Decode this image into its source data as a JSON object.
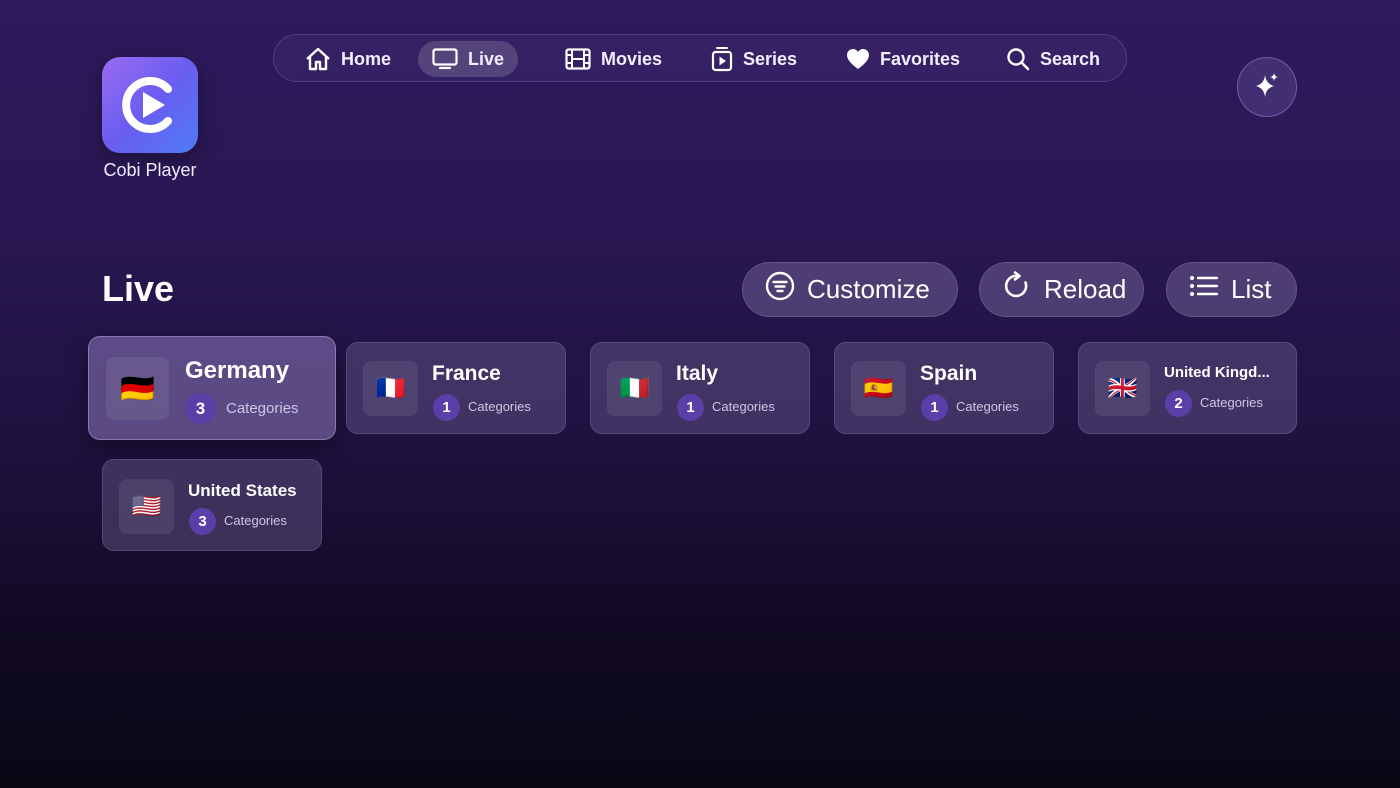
{
  "app": {
    "name": "Cobi Player"
  },
  "nav": {
    "items": [
      {
        "label": "Home",
        "icon": "home-icon"
      },
      {
        "label": "Live",
        "icon": "tv-icon",
        "active": true
      },
      {
        "label": "Movies",
        "icon": "film-icon"
      },
      {
        "label": "Series",
        "icon": "series-icon"
      },
      {
        "label": "Favorites",
        "icon": "heart-icon"
      },
      {
        "label": "Search",
        "icon": "search-icon"
      }
    ]
  },
  "page": {
    "title": "Live"
  },
  "actions": {
    "customize": "Customize",
    "reload": "Reload",
    "list": "List"
  },
  "countries": [
    {
      "name": "Germany",
      "count": "3",
      "sub": "Categories",
      "flag": "🇩🇪",
      "focused": true
    },
    {
      "name": "France",
      "count": "1",
      "sub": "Categories",
      "flag": "🇫🇷"
    },
    {
      "name": "Italy",
      "count": "1",
      "sub": "Categories",
      "flag": "🇮🇹"
    },
    {
      "name": "Spain",
      "count": "1",
      "sub": "Categories",
      "flag": "🇪🇸"
    },
    {
      "name": "United Kingd...",
      "count": "2",
      "sub": "Categories",
      "flag": "🇬🇧"
    },
    {
      "name": "United States",
      "count": "3",
      "sub": "Categories",
      "flag": "🇺🇸"
    }
  ],
  "colors": {
    "accent": "#5a3fa8",
    "logo_start": "#9a6cf0",
    "logo_end": "#4f7cf5"
  }
}
